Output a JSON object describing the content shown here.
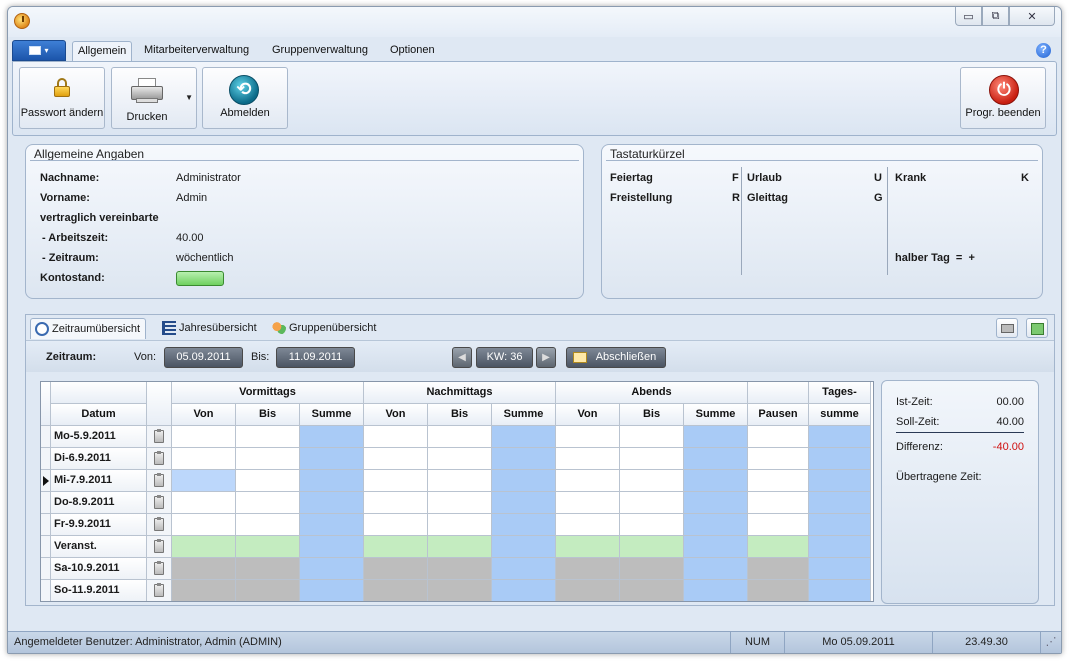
{
  "window": {
    "minimize": "▭",
    "restore": "⧉",
    "close": "✕"
  },
  "ribbon_tabs": [
    "Allgemein",
    "Mitarbeiterverwaltung",
    "Gruppenverwaltung",
    "Optionen"
  ],
  "ribbon_buttons": {
    "passwort": "Passwort ändern",
    "drucken": "Drucken",
    "abmelden": "Abmelden",
    "beenden": "Progr. beenden"
  },
  "general": {
    "title": "Allgemeine Angaben",
    "nachname_label": "Nachname:",
    "nachname": "Administrator",
    "vorname_label": "Vorname:",
    "vorname": "Admin",
    "vertraglich": "vertraglich vereinbarte",
    "arbeitszeit_label": "- Arbeitszeit:",
    "arbeitszeit": "40.00",
    "zeitraum_label": "- Zeitraum:",
    "zeitraum": "wöchentlich",
    "konto_label": "Kontostand:"
  },
  "shortcuts": {
    "title": "Tastaturkürzel",
    "items": [
      {
        "name": "Feiertag",
        "key": "F"
      },
      {
        "name": "Freistellung",
        "key": "R"
      },
      {
        "name": "Urlaub",
        "key": "U"
      },
      {
        "name": "Gleittag",
        "key": "G"
      },
      {
        "name": "Krank",
        "key": "K"
      }
    ],
    "halber_tag": "halber Tag  =  +"
  },
  "subtabs": [
    "Zeitraumübersicht",
    "Jahresübersicht",
    "Gruppenübersicht"
  ],
  "period": {
    "label": "Zeitraum:",
    "von_label": "Von:",
    "von": "05.09.2011",
    "bis_label": "Bis:",
    "bis": "11.09.2011",
    "prev": "◀",
    "kw": "KW: 36",
    "next": "▶",
    "abschliessen": "Abschließen"
  },
  "grid": {
    "groups": [
      "Vormittags",
      "Nachmittags",
      "Abends"
    ],
    "tages_top": "Tages-",
    "tages_bottom": "summe",
    "datum": "Datum",
    "von": "Von",
    "bis": "Bis",
    "summe": "Summe",
    "pausen": "Pausen",
    "rows": [
      {
        "label": "Mo-5.9.2011",
        "type": "work"
      },
      {
        "label": "Di-6.9.2011",
        "type": "work"
      },
      {
        "label": "Mi-7.9.2011",
        "type": "work"
      },
      {
        "label": "Do-8.9.2011",
        "type": "work"
      },
      {
        "label": "Fr-9.9.2011",
        "type": "work"
      },
      {
        "label": "Veranst.",
        "type": "event"
      },
      {
        "label": "Sa-10.9.2011",
        "type": "weekend"
      },
      {
        "label": "So-11.9.2011",
        "type": "weekend"
      }
    ]
  },
  "summary": {
    "ist_label": "Ist-Zeit:",
    "ist": "00.00",
    "soll_label": "Soll-Zeit:",
    "soll": "40.00",
    "diff_label": "Differenz:",
    "diff": "-40.00",
    "uebertragen_label": "Übertragene Zeit:"
  },
  "status": {
    "user": "Angemeldeter Benutzer: Administrator, Admin (ADMIN)",
    "num": "NUM",
    "date": "Mo 05.09.2011",
    "time": "23.49.30"
  },
  "colors": {
    "summe_blue": "#a9cbf6",
    "event_green": "#c4ecc0",
    "weekend_gray": "#bdbdbd",
    "selected_cell": "#bcd7fb",
    "negative_red": "#d01010"
  }
}
